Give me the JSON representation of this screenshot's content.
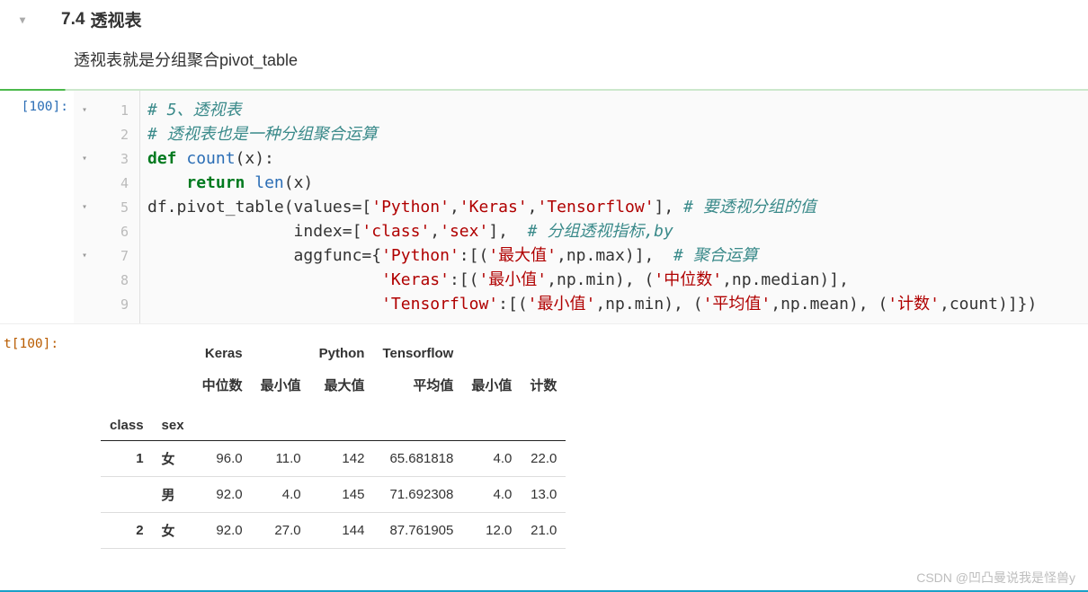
{
  "section": {
    "number": "7.4",
    "title": "透视表"
  },
  "markdown": {
    "text": "透视表就是分组聚合pivot_table"
  },
  "prompts": {
    "in": "[100]:",
    "out": "t[100]:"
  },
  "code": {
    "gutter": [
      {
        "fold": "▾",
        "ln": "1"
      },
      {
        "fold": "",
        "ln": "2"
      },
      {
        "fold": "▾",
        "ln": "3"
      },
      {
        "fold": "",
        "ln": "4"
      },
      {
        "fold": "▾",
        "ln": "5"
      },
      {
        "fold": "",
        "ln": "6"
      },
      {
        "fold": "▾",
        "ln": "7"
      },
      {
        "fold": "",
        "ln": "8"
      },
      {
        "fold": "",
        "ln": "9"
      }
    ],
    "tokens": {
      "l1_c1": "# 5、透视表",
      "l2_c1": "# 透视表也是一种分组聚合运算",
      "l3_kw": "def",
      "l3_fn": "count",
      "l3_rest": "(x):",
      "l4_kw": "return",
      "l4_fn": "len",
      "l4_rest": "(x)",
      "l5_pre": "df.pivot_table(values=[",
      "l5_s1": "'Python'",
      "l5_s2": "'Keras'",
      "l5_s3": "'Tensorflow'",
      "l5_post": "], ",
      "l5_c": "# 要透视分组的值",
      "l6_pre": "               index=[",
      "l6_s1": "'class'",
      "l6_s2": "'sex'",
      "l6_post": "],  ",
      "l6_c": "# 分组透视指标,by",
      "l7_pre": "               aggfunc={",
      "l7_s1": "'Python'",
      "l7_mid": ":[(",
      "l7_s2": "'最大值'",
      "l7_post": ",np.max)],  ",
      "l7_c": "# 聚合运算",
      "l8_pre": "                        ",
      "l8_s1": "'Keras'",
      "l8_mid1": ":[(",
      "l8_s2": "'最小值'",
      "l8_mid2": ",np.min), (",
      "l8_s3": "'中位数'",
      "l8_post": ",np.median)],",
      "l9_pre": "                        ",
      "l9_s1": "'Tensorflow'",
      "l9_mid1": ":[(",
      "l9_s2": "'最小值'",
      "l9_mid2": ",np.min), (",
      "l9_s3": "'平均值'",
      "l9_mid3": ",np.mean), (",
      "l9_s4": "'计数'",
      "l9_post": ",count)]})"
    }
  },
  "chart_data": {
    "type": "table",
    "top_headers": [
      "",
      "",
      "Keras",
      "",
      "Python",
      "Tensorflow",
      "",
      ""
    ],
    "sub_headers": [
      "",
      "",
      "中位数",
      "最小值",
      "最大值",
      "平均值",
      "最小值",
      "计数"
    ],
    "index_names": [
      "class",
      "sex"
    ],
    "rows": [
      {
        "class": "1",
        "sex": "女",
        "vals": [
          "96.0",
          "11.0",
          "142",
          "65.681818",
          "4.0",
          "22.0"
        ]
      },
      {
        "class": "",
        "sex": "男",
        "vals": [
          "92.0",
          "4.0",
          "145",
          "71.692308",
          "4.0",
          "13.0"
        ]
      },
      {
        "class": "2",
        "sex": "女",
        "vals": [
          "92.0",
          "27.0",
          "144",
          "87.761905",
          "12.0",
          "21.0"
        ]
      }
    ]
  },
  "watermark": "CSDN @凹凸曼说我是怪兽y"
}
